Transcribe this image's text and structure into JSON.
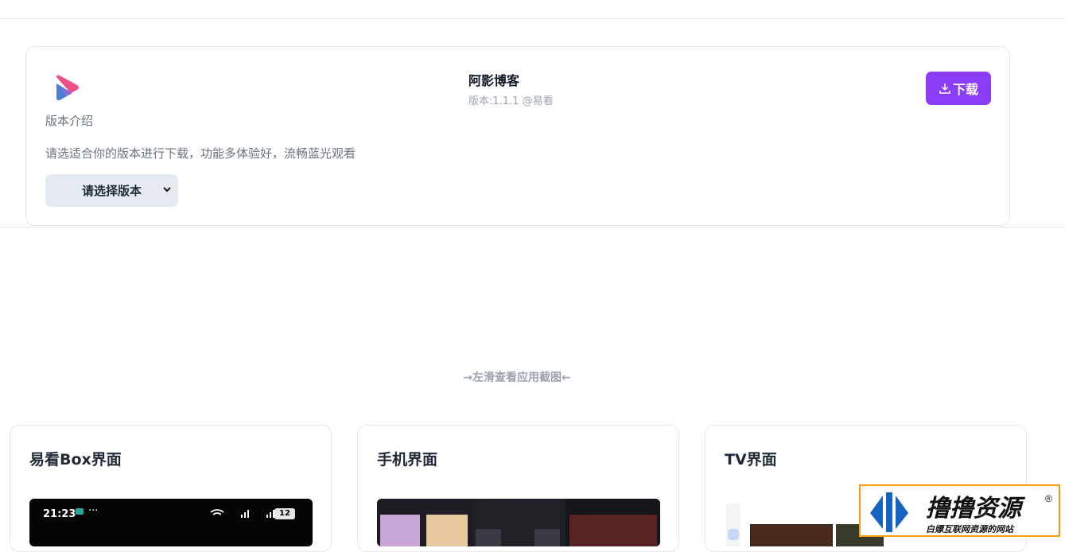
{
  "app": {
    "name": "阿影博客",
    "version_line": "版本:1.1.1 @易看",
    "intro_label": "版本介绍",
    "intro_text": "请选适合你的版本进行下载，功能多体验好，流畅蓝光观看",
    "select_value": "请选择版本",
    "download_label": "下载"
  },
  "hint": "→左滑查看应用截图←",
  "screenshots": [
    {
      "title": "易看Box界面",
      "status_time": "21:23",
      "battery": "12"
    },
    {
      "title": "手机界面"
    },
    {
      "title": "TV界面"
    }
  ],
  "colors": {
    "accent": "#8b3cf7",
    "border": "#e5e7eb",
    "muted": "#9ca3af"
  }
}
